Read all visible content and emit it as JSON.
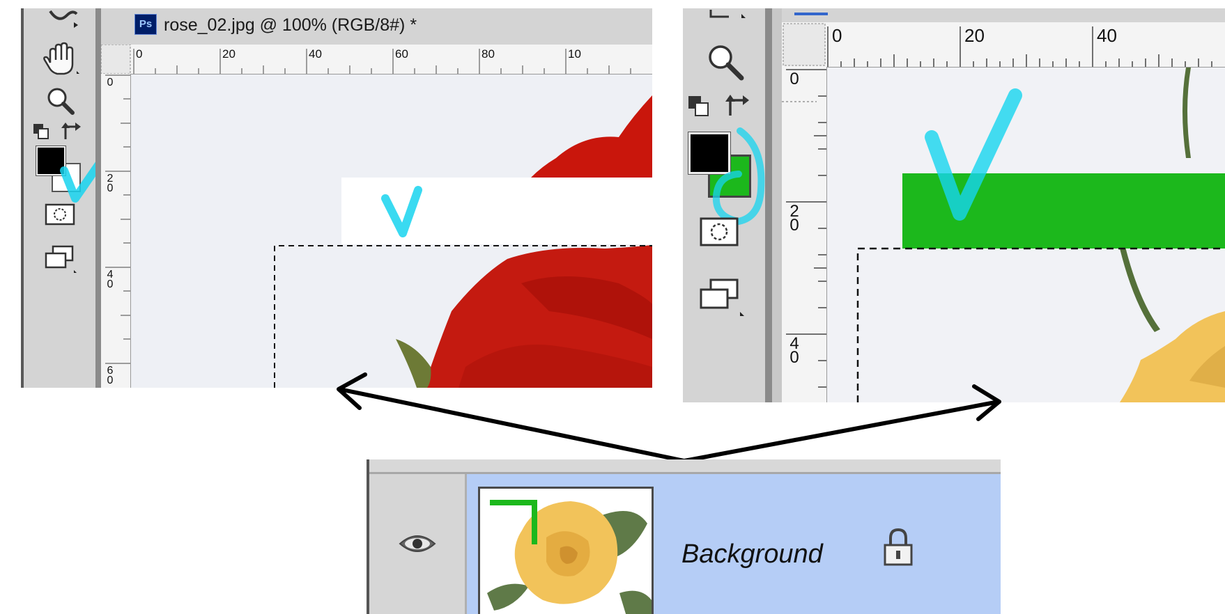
{
  "left_window": {
    "doc_badge": "Ps",
    "doc_title": "rose_02.jpg @ 100% (RGB/8#) *",
    "h_ruler_labels": [
      "0",
      "20",
      "40",
      "60",
      "80",
      "10"
    ],
    "v_ruler_labels": [
      [
        "0"
      ],
      [
        "2",
        "0"
      ],
      [
        "4",
        "0"
      ],
      [
        "6",
        "0"
      ]
    ]
  },
  "right_window": {
    "h_ruler_labels": [
      "0",
      "20",
      "40"
    ],
    "v_ruler_labels": [
      [
        "0"
      ],
      [
        "2",
        "0"
      ],
      [
        "4",
        "0"
      ]
    ]
  },
  "layers": {
    "layer_name": "Background",
    "visibility_icon": "eye-icon",
    "lock_icon": "lock-icon"
  },
  "colors": {
    "foreground_swatch": "#000000",
    "background_swatch_left": "#ffffff",
    "background_swatch_right": "#1cb81c",
    "annotation_check": "#17d4ef",
    "green_fill": "#1cb81c",
    "layer_selected": "#b5cdf6",
    "rose_red": "#c9160c",
    "rose_yellow": "#f2c35a"
  }
}
